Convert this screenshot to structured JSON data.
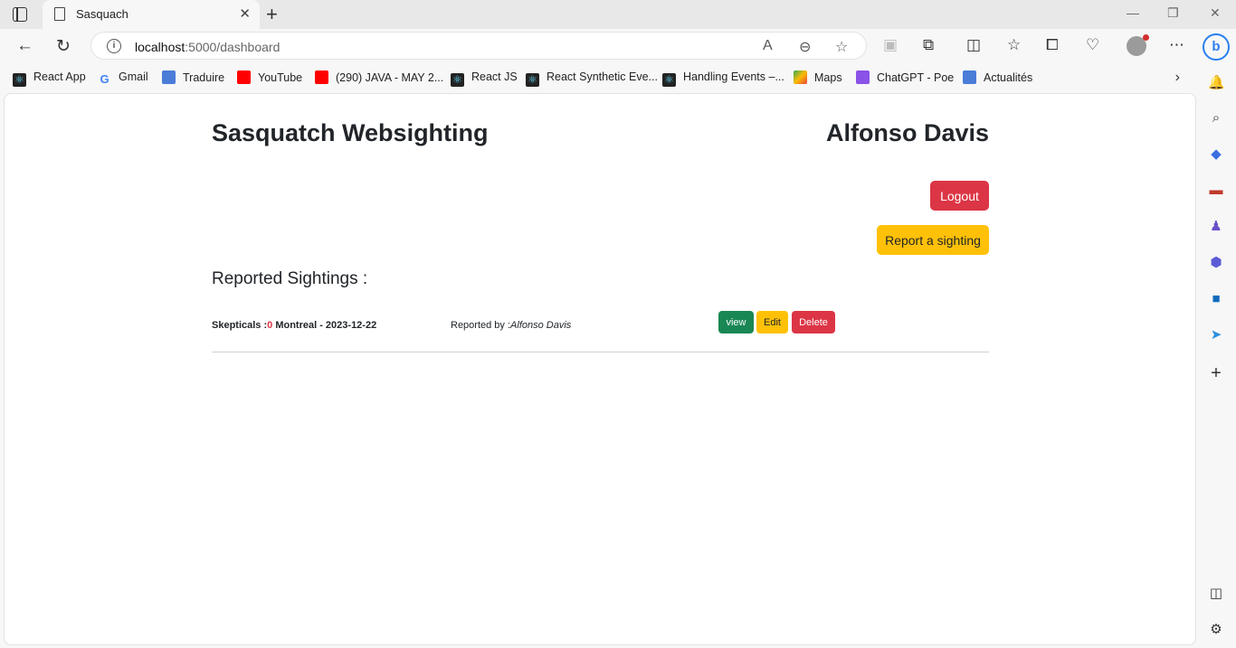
{
  "browser": {
    "tab_title": "Sasquach",
    "url_host": "localhost",
    "url_path": ":5000/dashboard",
    "bookmarks": [
      {
        "label": "React App",
        "icon": "react-icon"
      },
      {
        "label": "Gmail",
        "icon": "google-icon"
      },
      {
        "label": "Traduire",
        "icon": "translate-icon"
      },
      {
        "label": "YouTube",
        "icon": "youtube-icon"
      },
      {
        "label": "(290) JAVA - MAY 2...",
        "icon": "youtube-icon"
      },
      {
        "label": "React JS",
        "icon": "react-icon"
      },
      {
        "label": "React Synthetic Eve...",
        "icon": "react-icon"
      },
      {
        "label": "Handling Events –...",
        "icon": "react-icon"
      },
      {
        "label": "Maps",
        "icon": "maps-icon"
      },
      {
        "label": "ChatGPT - Poe",
        "icon": "poe-icon"
      },
      {
        "label": "Actualités",
        "icon": "news-icon"
      }
    ]
  },
  "page": {
    "brand": "Sasquatch Websighting",
    "user_name": "Alfonso Davis",
    "logout_label": "Logout",
    "report_label": "Report a sighting",
    "section_title": "Reported Sightings :",
    "sightings": [
      {
        "skeptical_label": "Skepticals :",
        "skeptical_count": "0",
        "place_date": " Montreal - 2023-12-22",
        "reported_by_label": "Reported by :",
        "reporter": "Alfonso Davis",
        "view_label": "view",
        "edit_label": "Edit",
        "delete_label": "Delete"
      }
    ]
  },
  "colors": {
    "danger": "#dc3545",
    "warning": "#ffc107",
    "success": "#198754"
  }
}
